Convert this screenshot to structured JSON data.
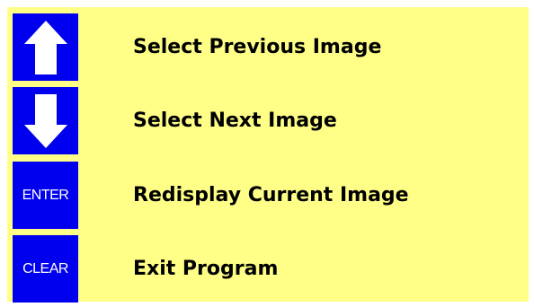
{
  "colors": {
    "panel_background": "#ffff88",
    "key_background": "#0000ee",
    "key_foreground": "#ffffff",
    "label_text": "#000000"
  },
  "rows": [
    {
      "key_icon": "up-arrow-icon",
      "label": "Select Previous Image"
    },
    {
      "key_icon": "down-arrow-icon",
      "label": "Select Next Image"
    },
    {
      "key_text": "ENTER",
      "label": "Redisplay Current Image"
    },
    {
      "key_text": "CLEAR",
      "label": "Exit Program"
    }
  ]
}
